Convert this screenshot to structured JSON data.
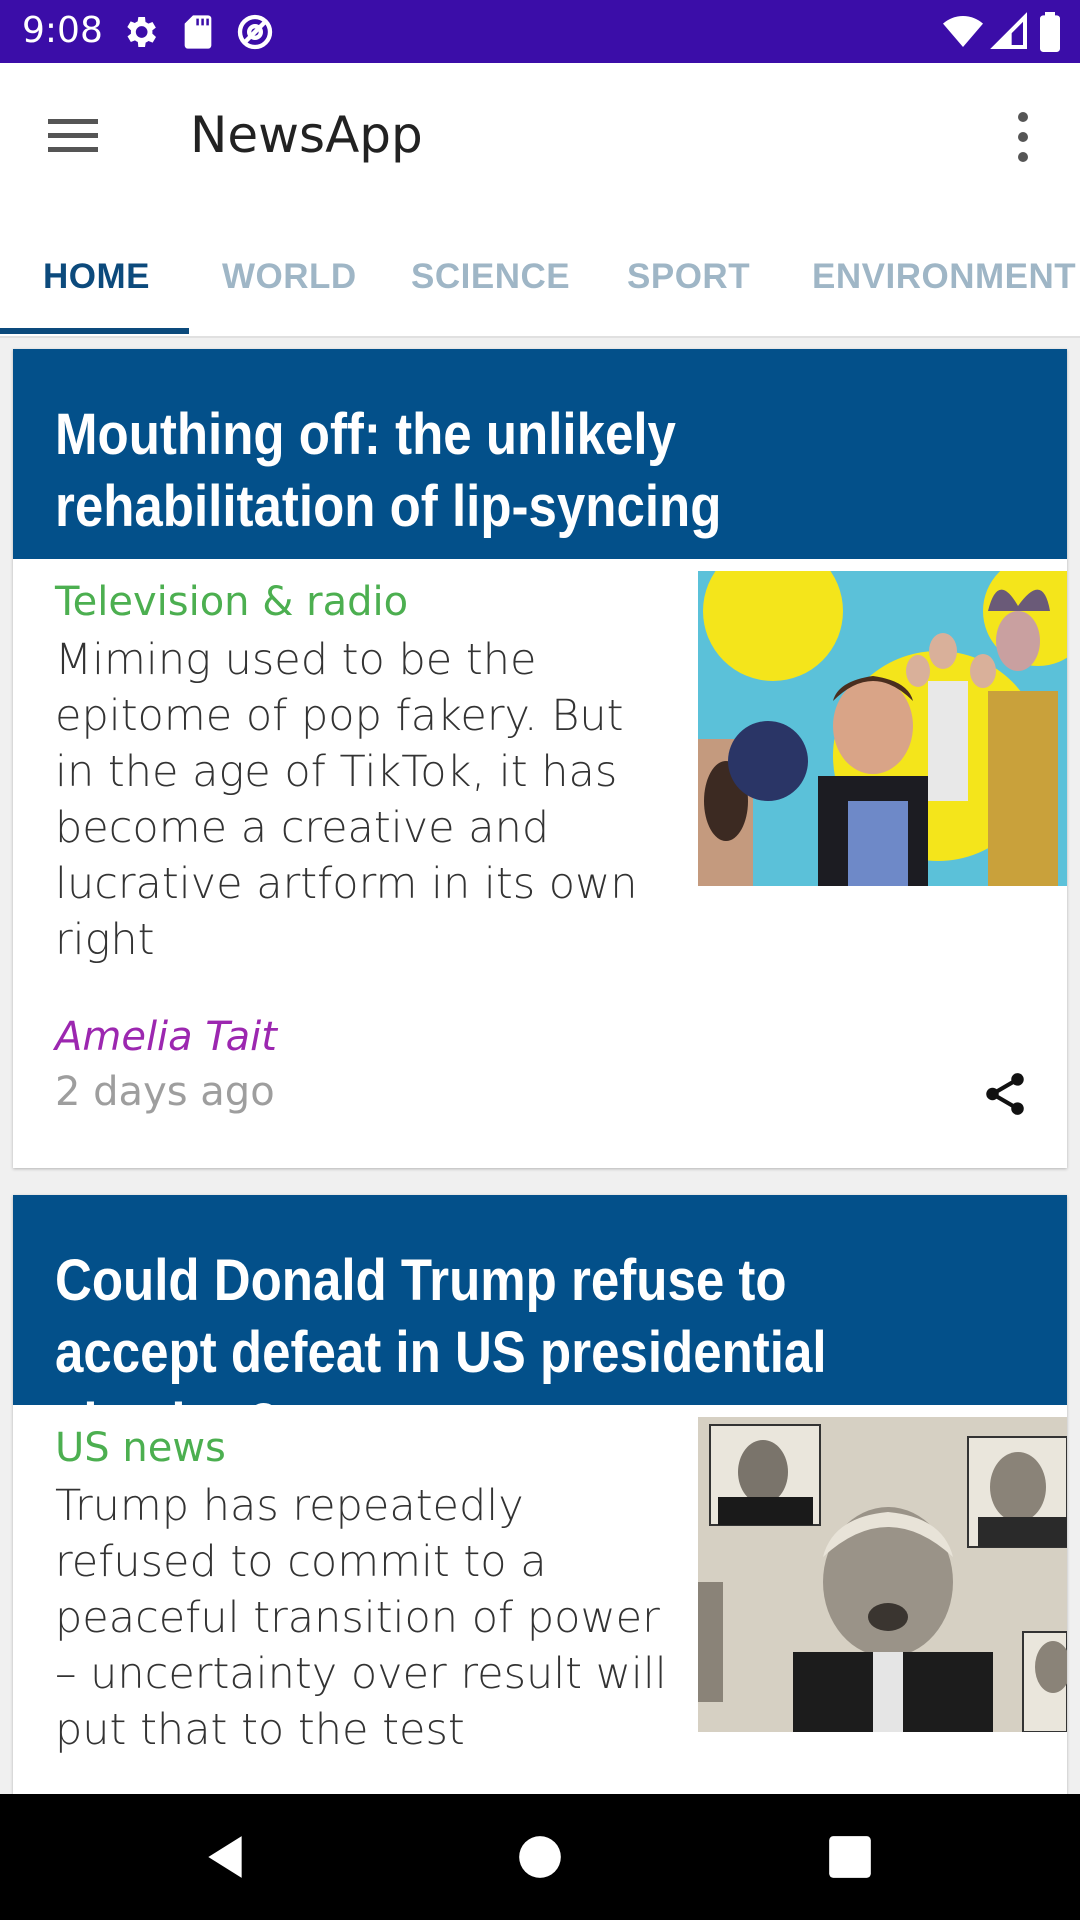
{
  "status_bar": {
    "time": "9:08",
    "left_icons": [
      "gear-icon",
      "sd-card-icon",
      "at-sign-icon"
    ],
    "right_icons": [
      "wifi-icon",
      "signal-icon",
      "battery-icon"
    ]
  },
  "app_bar": {
    "menu_icon": "hamburger-menu-icon",
    "title": "NewsApp",
    "overflow_icon": "more-vert-icon"
  },
  "tabs": [
    {
      "label": "HOME",
      "active": true
    },
    {
      "label": "WORLD",
      "active": false
    },
    {
      "label": "SCIENCE",
      "active": false
    },
    {
      "label": "SPORT",
      "active": false
    },
    {
      "label": "ENVIRONMENT",
      "active": false
    }
  ],
  "articles": [
    {
      "title": "Mouthing off: the unlikely rehabilitation of lip-syncing",
      "section": "Television & radio",
      "summary": "Miming used to be the epitome of pop fakery. But in the age of TikTok, it has become a creative and lucrative artform in its own right",
      "author": "Amelia Tait",
      "time_ago": "2 days ago",
      "share_icon": "share-icon"
    },
    {
      "title": "Could Donald Trump refuse to accept defeat in US presidential election?",
      "section": "US news",
      "summary": "Trump has repeatedly refused to commit to a peaceful transition of power – uncertainty over result will put that to the test"
    }
  ],
  "nav_bar": {
    "buttons": [
      "back-icon",
      "home-icon",
      "recents-icon"
    ]
  },
  "colors": {
    "status_bar": "#3b0da8",
    "card_header": "#03508a",
    "active_tab": "#0c4a7c",
    "inactive_tab": "#9fb6c6",
    "section": "#4caf50",
    "author": "#9c27b0"
  }
}
